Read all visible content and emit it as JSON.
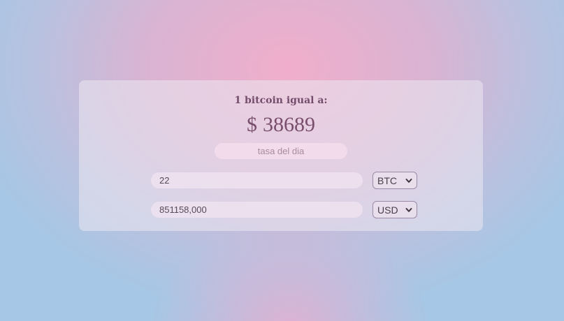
{
  "converter": {
    "heading": "1 bitcoin igual a:",
    "rate_symbol": "$",
    "rate_value": "38689",
    "rate_caption": "tasa del dia",
    "rows": [
      {
        "amount": "22",
        "currency": "BTC"
      },
      {
        "amount": "851158,000",
        "currency": "USD"
      }
    ]
  },
  "icons": {
    "select_arrow": "chevron-down-icon"
  },
  "colors": {
    "text_accent": "#744d6c",
    "caption": "#a98aa2"
  }
}
